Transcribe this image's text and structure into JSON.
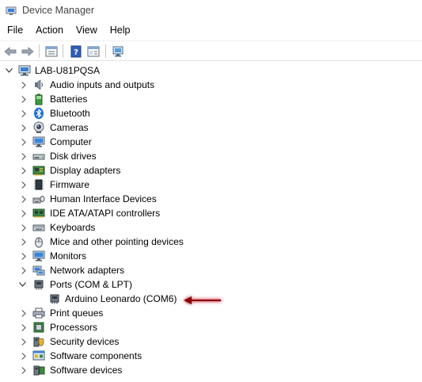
{
  "window": {
    "title": "Device Manager"
  },
  "menu": [
    {
      "id": "file",
      "label": "File"
    },
    {
      "id": "action",
      "label": "Action"
    },
    {
      "id": "view",
      "label": "View"
    },
    {
      "id": "help",
      "label": "Help"
    }
  ],
  "toolbar": [
    {
      "name": "back-icon"
    },
    {
      "name": "forward-icon"
    },
    {
      "name": "properties-icon"
    },
    {
      "name": "help-icon"
    },
    {
      "name": "show-hide-console-icon"
    },
    {
      "name": "scan-hardware-icon"
    }
  ],
  "tree": {
    "root": {
      "label": "LAB-U81PQSA",
      "expanded": true,
      "icon": "computer-icon"
    },
    "categories": [
      {
        "label": "Audio inputs and outputs",
        "icon": "speaker-icon",
        "expanded": false
      },
      {
        "label": "Batteries",
        "icon": "battery-icon",
        "expanded": false
      },
      {
        "label": "Bluetooth",
        "icon": "bluetooth-icon",
        "expanded": false
      },
      {
        "label": "Cameras",
        "icon": "camera-icon",
        "expanded": false
      },
      {
        "label": "Computer",
        "icon": "monitor-icon",
        "expanded": false
      },
      {
        "label": "Disk drives",
        "icon": "disk-drive-icon",
        "expanded": false
      },
      {
        "label": "Display adapters",
        "icon": "display-adapter-icon",
        "expanded": false
      },
      {
        "label": "Firmware",
        "icon": "firmware-icon",
        "expanded": false
      },
      {
        "label": "Human Interface Devices",
        "icon": "hid-icon",
        "expanded": false
      },
      {
        "label": "IDE ATA/ATAPI controllers",
        "icon": "ide-controller-icon",
        "expanded": false
      },
      {
        "label": "Keyboards",
        "icon": "keyboard-icon",
        "expanded": false
      },
      {
        "label": "Mice and other pointing devices",
        "icon": "mouse-icon",
        "expanded": false
      },
      {
        "label": "Monitors",
        "icon": "monitor-icon",
        "expanded": false
      },
      {
        "label": "Network adapters",
        "icon": "network-adapter-icon",
        "expanded": false
      },
      {
        "label": "Ports (COM & LPT)",
        "icon": "port-icon",
        "expanded": true,
        "children": [
          {
            "label": "Arduino Leonardo (COM6)",
            "icon": "port-icon"
          }
        ]
      },
      {
        "label": "Print queues",
        "icon": "printer-icon",
        "expanded": false
      },
      {
        "label": "Processors",
        "icon": "processor-icon",
        "expanded": false
      },
      {
        "label": "Security devices",
        "icon": "security-device-icon",
        "expanded": false
      },
      {
        "label": "Software components",
        "icon": "software-component-icon",
        "expanded": false
      },
      {
        "label": "Software devices",
        "icon": "software-device-icon",
        "expanded": false
      }
    ]
  },
  "annotation": {
    "icon": "red-arrow-icon",
    "color": "#8b0000"
  }
}
